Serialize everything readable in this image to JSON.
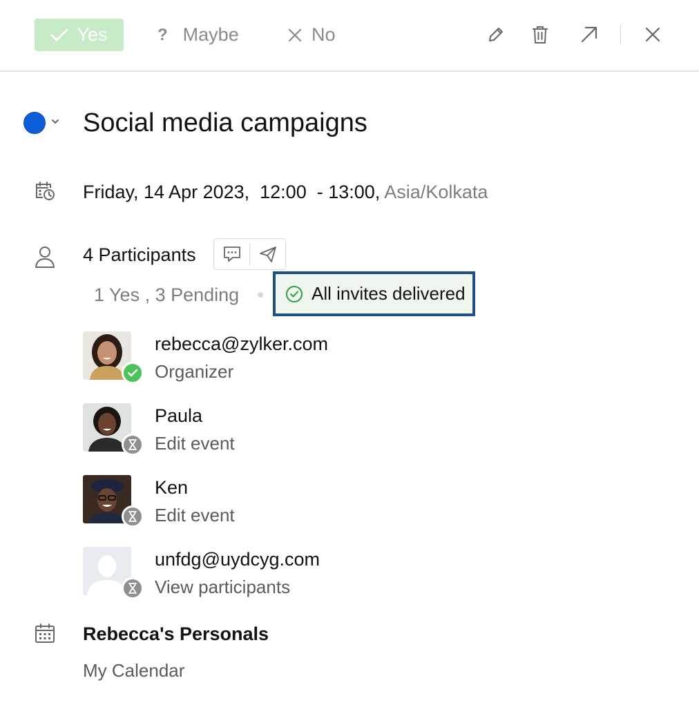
{
  "rsvp": {
    "yes_label": "Yes",
    "maybe_glyph": "?",
    "maybe_label": "Maybe",
    "no_label": "No"
  },
  "toolbar": {
    "icons": [
      "edit-icon",
      "trash-icon",
      "open-external-icon",
      "close-icon"
    ]
  },
  "event": {
    "color": "#0c5fd8",
    "title": "Social media campaigns",
    "datetime": "Friday, 14 Apr 2023,  12:00  - 13:00,",
    "timezone": "Asia/Kolkata"
  },
  "participants": {
    "title": "4 Participants",
    "summary": "1 Yes , 3 Pending",
    "delivery_status": "All invites delivered",
    "list": [
      {
        "name": "rebecca@zylker.com",
        "role": "Organizer",
        "status": "accepted"
      },
      {
        "name": "Paula",
        "role": "Edit event",
        "status": "pending"
      },
      {
        "name": "Ken",
        "role": "Edit event",
        "status": "pending"
      },
      {
        "name": "unfdg@uydcyg.com",
        "role": "View participants",
        "status": "pending"
      }
    ]
  },
  "calendar": {
    "name": "Rebecca's Personals",
    "subtitle": "My Calendar"
  },
  "colors": {
    "accent_green": "#4cc35a",
    "yes_bg": "#c6ebc6",
    "highlight_border": "#1f4f86"
  }
}
